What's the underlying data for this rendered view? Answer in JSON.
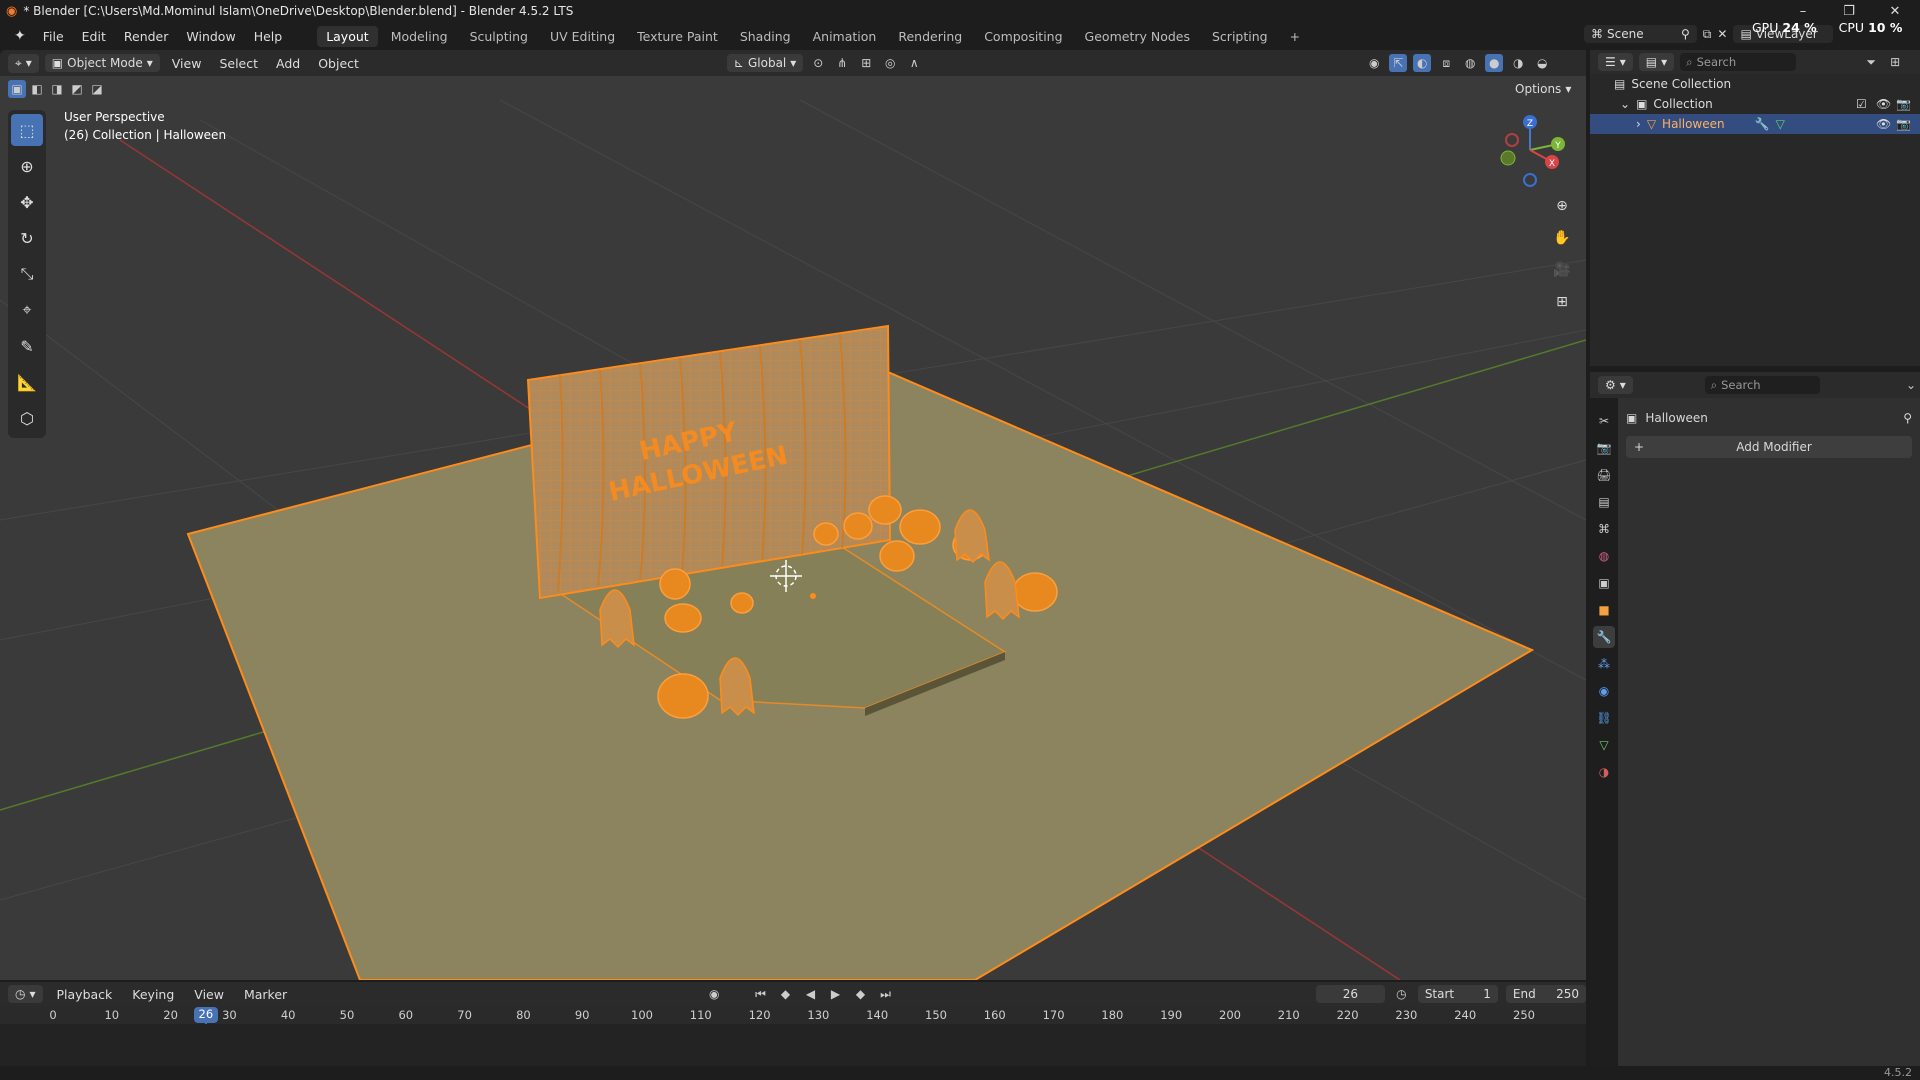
{
  "window": {
    "title": "* Blender [C:\\Users\\Md.Mominul Islam\\OneDrive\\Desktop\\Blender.blend] - Blender 4.5.2 LTS",
    "controls": [
      "–",
      "❐",
      "✕"
    ]
  },
  "menu": [
    "File",
    "Edit",
    "Render",
    "Window",
    "Help"
  ],
  "workspaces": [
    {
      "label": "Layout",
      "active": true
    },
    {
      "label": "Modeling"
    },
    {
      "label": "Sculpting"
    },
    {
      "label": "UV Editing"
    },
    {
      "label": "Texture Paint"
    },
    {
      "label": "Shading"
    },
    {
      "label": "Animation"
    },
    {
      "label": "Rendering"
    },
    {
      "label": "Compositing"
    },
    {
      "label": "Geometry Nodes"
    },
    {
      "label": "Scripting"
    }
  ],
  "topright": {
    "scene": "Scene",
    "viewlayer": "ViewLayer",
    "gpu_label": "GPU",
    "gpu_value": "24 %",
    "cpu_label": "CPU",
    "cpu_value": "10 %"
  },
  "viewport_header": {
    "mode": "Object Mode",
    "menus": [
      "View",
      "Select",
      "Add",
      "Object"
    ],
    "transform_orientation": "Global",
    "options": "Options"
  },
  "viewport": {
    "perspective": "User Perspective",
    "info": "(26) Collection | Halloween",
    "gizmo_axes": {
      "x": "X",
      "y": "Y",
      "z": "Z"
    },
    "colors": {
      "bg": "#3a3a3a",
      "floor": "#8b845e",
      "outline": "#ff8c1a",
      "x_axis": "#9a3535",
      "y_axis": "#557a2a"
    }
  },
  "timeline": {
    "menus": [
      "Playback",
      "Keying",
      "View",
      "Marker"
    ],
    "current_frame": "26",
    "start_label": "Start",
    "start": "1",
    "end_label": "End",
    "end": "250",
    "ticks": [
      "0",
      "10",
      "20",
      "30",
      "40",
      "50",
      "60",
      "70",
      "80",
      "90",
      "100",
      "110",
      "120",
      "130",
      "140",
      "150",
      "160",
      "170",
      "180",
      "190",
      "200",
      "210",
      "220",
      "230",
      "240",
      "250"
    ],
    "playhead_label": "26"
  },
  "outliner": {
    "search_placeholder": "Search",
    "items": [
      {
        "label": "Scene Collection"
      },
      {
        "label": "Collection"
      },
      {
        "label": "Halloween"
      }
    ]
  },
  "properties": {
    "search_placeholder": "Search",
    "object_name": "Halloween",
    "add_modifier": "Add Modifier"
  },
  "statusbar": {
    "version": "4.5.2"
  }
}
